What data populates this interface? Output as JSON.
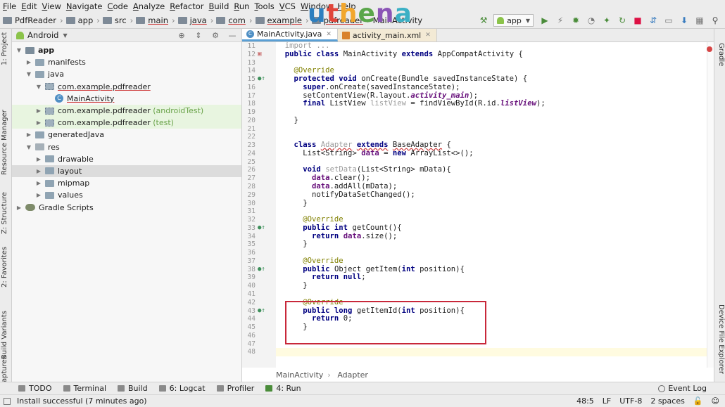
{
  "menu": [
    "File",
    "Edit",
    "View",
    "Navigate",
    "Code",
    "Analyze",
    "Refactor",
    "Build",
    "Run",
    "Tools",
    "VCS",
    "Window",
    "Help"
  ],
  "watermark": {
    "u": "u",
    "t": "t",
    "h": "h",
    "e": "e",
    "n": "n",
    "a": "a"
  },
  "breadcrumbs": [
    "PdfReader",
    "app",
    "src",
    "main",
    "java",
    "com",
    "example",
    "pdfreader",
    "MainActivity"
  ],
  "toolbar": {
    "run_config": "app"
  },
  "left_tools": [
    "1: Project",
    "Resource Manager",
    "Z: Structure",
    "2: Favorites",
    "Build Variants",
    "Captures"
  ],
  "right_tools": [
    "Gradle",
    "Device File Explorer"
  ],
  "project": {
    "view": "Android",
    "tree": [
      {
        "label": "app",
        "depth": 0
      },
      {
        "label": "manifests",
        "depth": 1
      },
      {
        "label": "java",
        "depth": 1
      },
      {
        "label": "com.example.pdfreader",
        "depth": 2
      },
      {
        "label": "MainActivity",
        "depth": 3
      },
      {
        "label": "com.example.pdfreader",
        "suffix": "(androidTest)",
        "depth": 2
      },
      {
        "label": "com.example.pdfreader",
        "suffix": "(test)",
        "depth": 2
      },
      {
        "label": "generatedJava",
        "depth": 1
      },
      {
        "label": "res",
        "depth": 1
      },
      {
        "label": "drawable",
        "depth": 2
      },
      {
        "label": "layout",
        "depth": 2
      },
      {
        "label": "mipmap",
        "depth": 2
      },
      {
        "label": "values",
        "depth": 2
      },
      {
        "label": "Gradle Scripts",
        "depth": 0
      }
    ]
  },
  "tabs": [
    {
      "label": "MainActivity.java"
    },
    {
      "label": "activity_main.xml"
    }
  ],
  "line_numbers": [
    "11",
    "12",
    "13",
    "14",
    "15",
    "16",
    "17",
    "18",
    "19",
    "20",
    "21",
    "22",
    "23",
    "24",
    "25",
    "26",
    "27",
    "28",
    "29",
    "30",
    "31",
    "32",
    "33",
    "34",
    "35",
    "36",
    "37",
    "38",
    "39",
    "40",
    "41",
    "42",
    "43",
    "44",
    "45",
    "46",
    "47",
    "48"
  ],
  "code": {
    "l11": "import ...",
    "l12a": "public class",
    "l12b": " MainActivity ",
    "l12c": "extends",
    "l12d": " AppCompatActivity {",
    "l14": "@Override",
    "l15a": "protected void",
    "l15b": " onCreate(Bundle savedInstanceState) {",
    "l16a": "super",
    "l16b": ".onCreate(savedInstanceState);",
    "l17a": "setContentView(R.layout.",
    "l17b": "activity_main",
    "l17c": ");",
    "l18a": "final",
    "l18b": " ListView ",
    "l18c": "listView",
    "l18d": " = findViewById(R.id.",
    "l18e": "listView",
    "l18f": ");",
    "l20": "}",
    "l23a": "class",
    "l23b": "Adapter",
    "l23c": "extends",
    "l23d": "BaseAdapter",
    "l23e": " {",
    "l24a": "List<String> ",
    "l24b": "data",
    "l24c": " = ",
    "l24d": "new",
    "l24e": " ArrayList<>();",
    "l26a": "void",
    "l26b": "setData",
    "l26c": "(List<String> mData){",
    "l27a": "data",
    "l27b": ".clear();",
    "l28a": "data",
    "l28b": ".addAll(mData);",
    "l29": "notifyDataSetChanged();",
    "l30": "}",
    "l32": "@Override",
    "l33a": "public int",
    "l33b": " getCount(){",
    "l34a": "return",
    "l34b": "data",
    "l34c": ".size();",
    "l35": "}",
    "l37": "@Override",
    "l38a": "public",
    "l38b": " Object getItem(",
    "l38c": "int",
    "l38d": " position){",
    "l39a": "return null",
    "l39b": ";",
    "l40": "}",
    "l42": "@Override",
    "l43a": "public long",
    "l43b": " getItemId(",
    "l43c": "int",
    "l43d": " position){",
    "l44a": "return",
    "l44b": " 0;",
    "l45": "}"
  },
  "editor_breadcrumbs": [
    "MainActivity",
    "Adapter"
  ],
  "bottom_tools": [
    "TODO",
    "Terminal",
    "Build",
    "6: Logcat",
    "Profiler",
    "4: Run"
  ],
  "event_log": "Event Log",
  "status": {
    "message": "Install successful (7 minutes ago)",
    "position": "48:5",
    "line_sep": "LF",
    "encoding": "UTF-8",
    "indent": "2 spaces"
  }
}
